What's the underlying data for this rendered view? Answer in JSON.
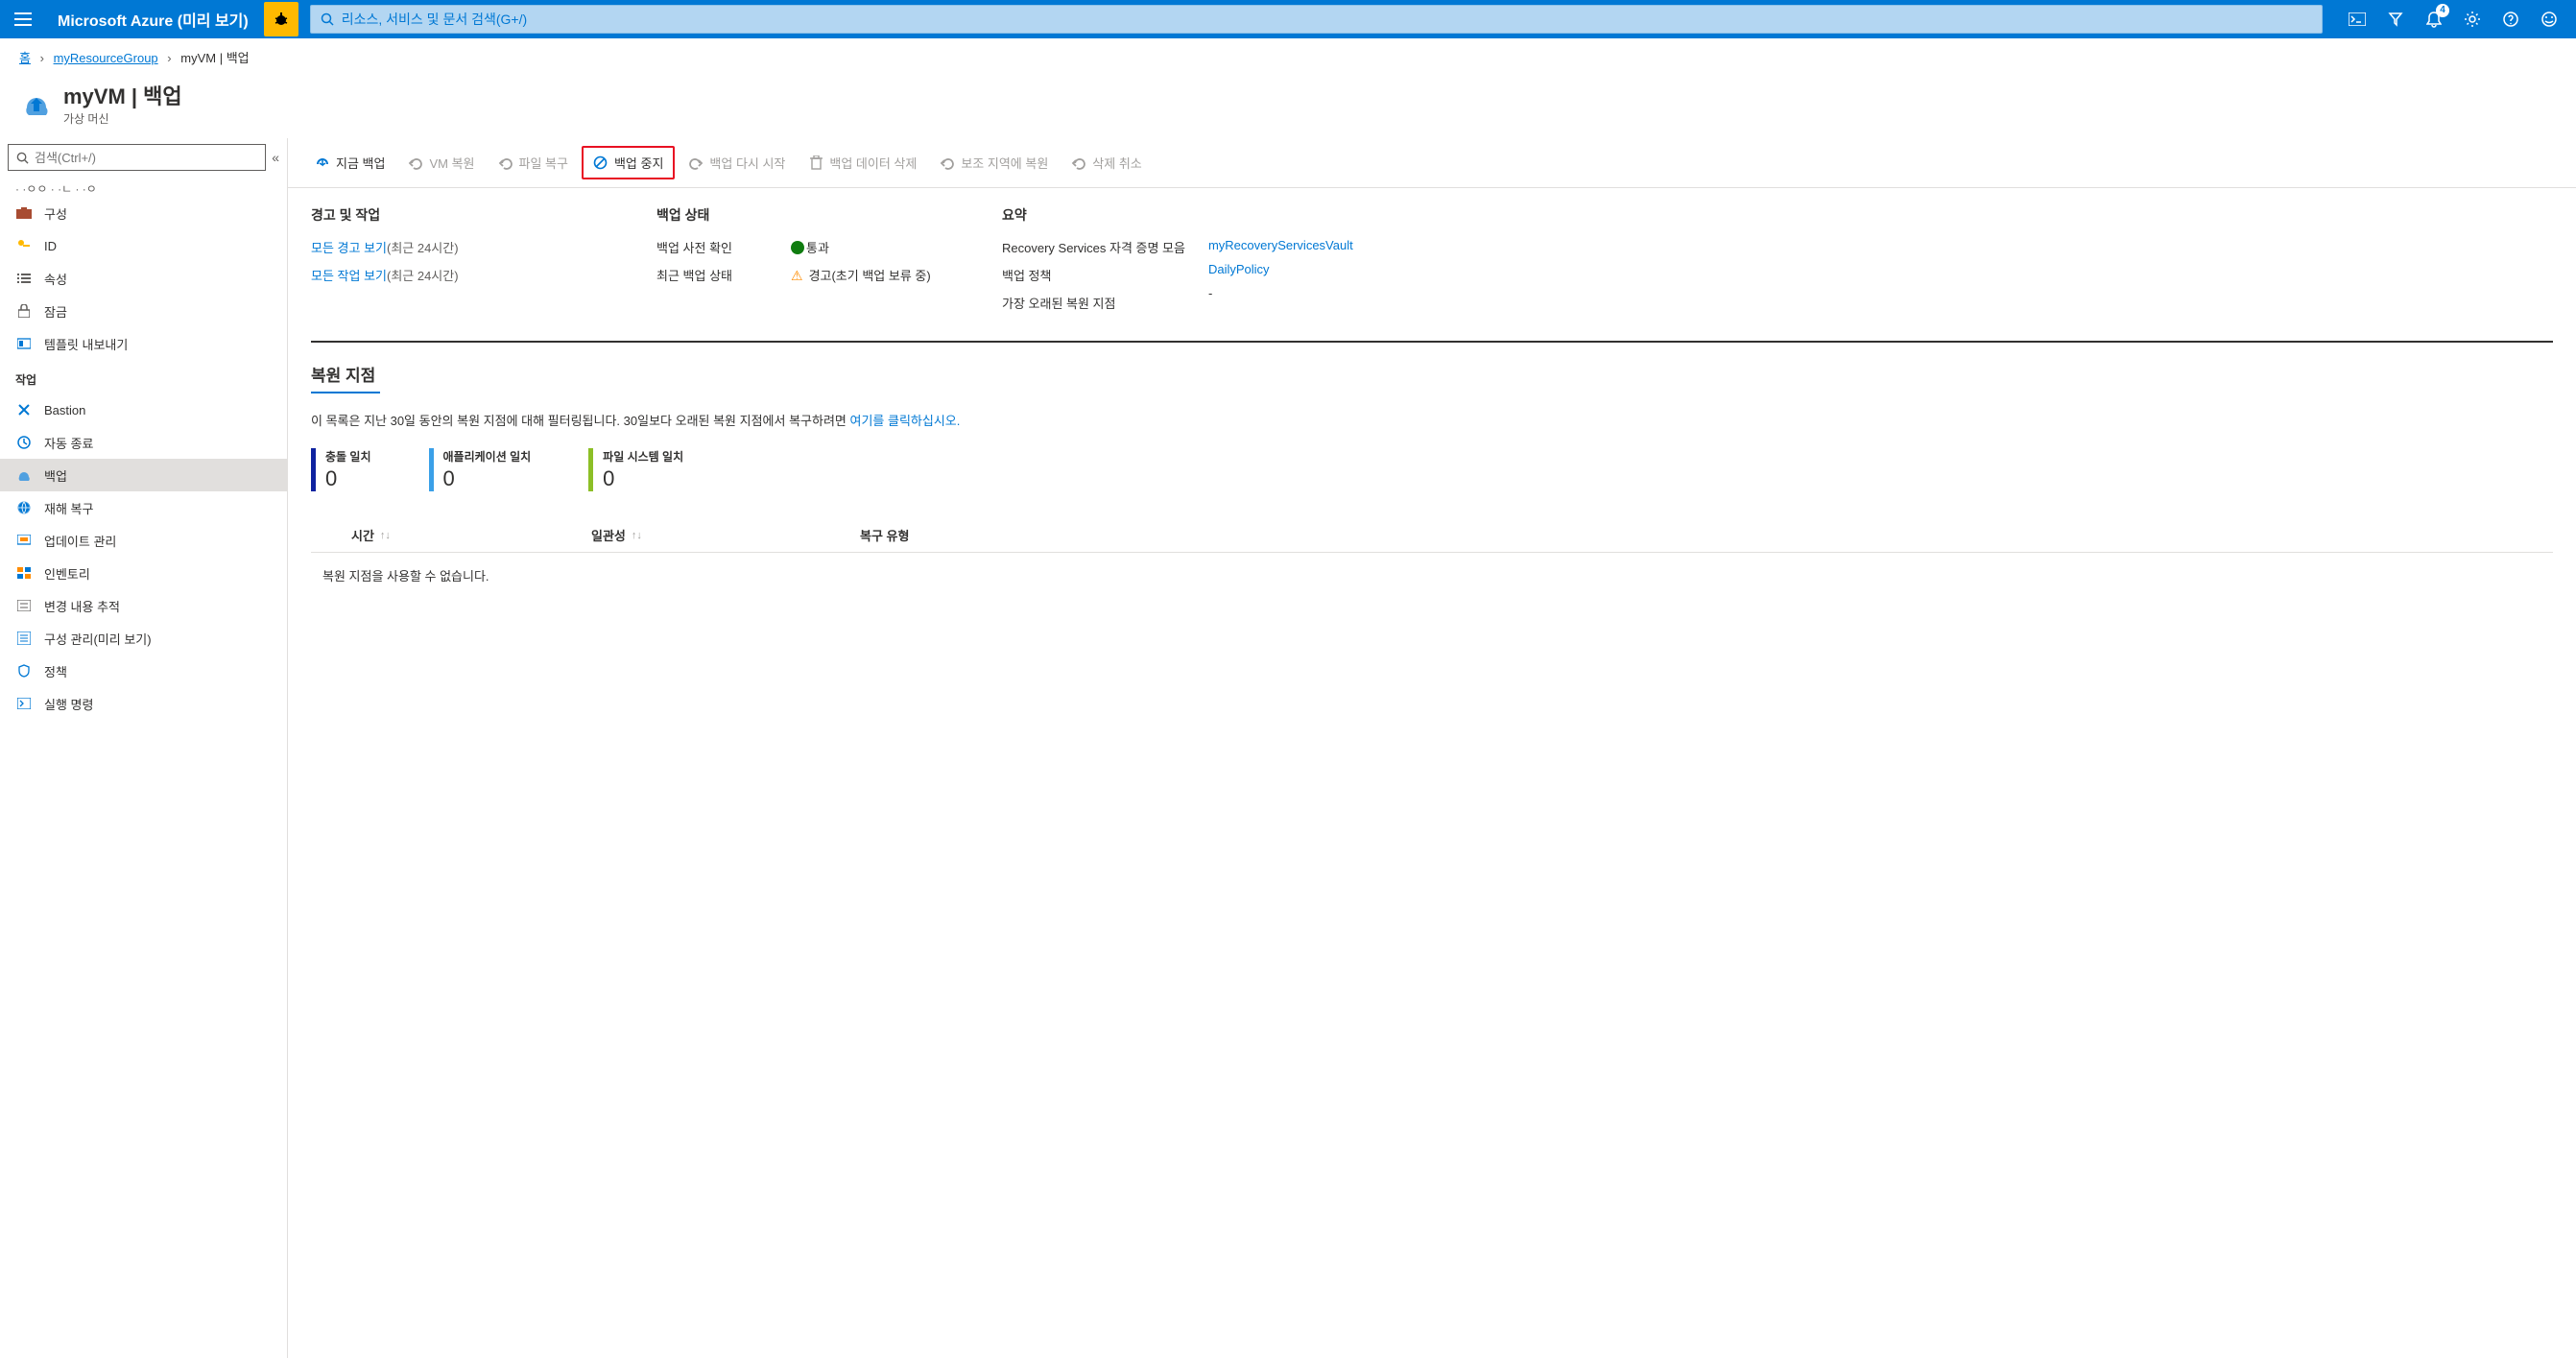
{
  "topbar": {
    "brand": "Microsoft Azure (미리 보기)",
    "search_placeholder": "리소스, 서비스 및 문서 검색(G+/)",
    "notification_count": "4"
  },
  "breadcrumb": {
    "home": "홈",
    "group": "myResourceGroup",
    "current": "myVM | 백업"
  },
  "page": {
    "title": "myVM | 백업",
    "subtitle": "가상 머신"
  },
  "sidebar": {
    "search_placeholder": "검색(Ctrl+/)",
    "truncated": "· ·ㅇㅇ · ·ㄴ · ·ㅇ",
    "items_top": [
      "구성",
      "ID",
      "속성",
      "잠금",
      "템플릿 내보내기"
    ],
    "group_label": "작업",
    "items_ops": [
      "Bastion",
      "자동 종료",
      "백업",
      "재해 복구",
      "업데이트 관리",
      "인벤토리",
      "변경 내용 추적",
      "구성 관리(미리 보기)",
      "정책",
      "실행 명령"
    ]
  },
  "toolbar": {
    "backup_now": "지금 백업",
    "vm_restore": "VM 복원",
    "file_recovery": "파일 복구",
    "stop_backup": "백업 중지",
    "resume_backup": "백업 다시 시작",
    "delete_data": "백업 데이터 삭제",
    "restore_secondary": "보조 지역에 복원",
    "undo_delete": "삭제 취소"
  },
  "alerts": {
    "title": "경고 및 작업",
    "all_alerts": "모든 경고 보기",
    "all_jobs": "모든 작업 보기",
    "timeframe": "(최근 24시간)"
  },
  "status": {
    "title": "백업 상태",
    "precheck_label": "백업 사전 확인",
    "precheck_value": "통과",
    "last_label": "최근 백업 상태",
    "last_value": "경고(초기 백업 보류 중)"
  },
  "summary": {
    "title": "요약",
    "vault_label": "Recovery Services 자격 증명 모음",
    "vault_value": "myRecoveryServicesVault",
    "policy_label": "백업 정책",
    "policy_value": "DailyPolicy",
    "oldest_label": "가장 오래된 복원 지점",
    "oldest_value": "-"
  },
  "restore": {
    "title": "복원 지점",
    "note_prefix": "이 목록은 지난 30일 동안의 복원 지점에 대해 필터링됩니다. 30일보다 오래된 복원 지점에서 복구하려면 ",
    "note_link": "여기를 클릭하십시오.",
    "counters": {
      "crash": {
        "label": "충돌 일치",
        "value": "0"
      },
      "app": {
        "label": "애플리케이션 일치",
        "value": "0"
      },
      "fs": {
        "label": "파일 시스템 일치",
        "value": "0"
      }
    },
    "columns": {
      "time": "시간",
      "consistency": "일관성",
      "recovery_type": "복구 유형"
    },
    "empty": "복원 지점을 사용할 수 없습니다."
  }
}
